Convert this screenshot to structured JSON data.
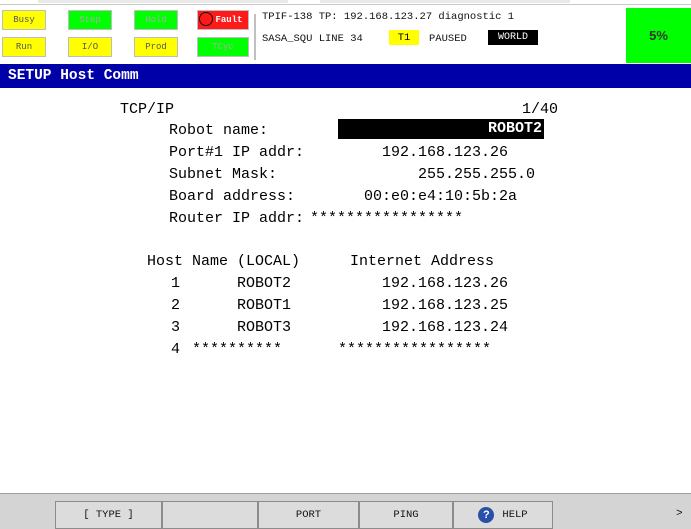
{
  "status": {
    "leds_top": [
      {
        "label": "Busy",
        "color": "#ffff00"
      },
      {
        "label": "Step",
        "color": "#00ff00"
      },
      {
        "label": "Hold",
        "color": "#00ff00"
      },
      {
        "label": "Fault",
        "color": "#ff1a1a"
      }
    ],
    "leds_bottom": [
      {
        "label": "Run",
        "color": "#ffff00"
      },
      {
        "label": "I/O",
        "color": "#ffff00"
      },
      {
        "label": "Prod",
        "color": "#ffff00"
      },
      {
        "label": "TCyc",
        "color": "#00ff00"
      }
    ],
    "message_line1": "TPIF-138 TP: 192.168.123.27 diagnostic 1",
    "program": "SASA_SQU LINE 34",
    "mode_badge": "T1",
    "run_state": "PAUSED",
    "coord_badge": "WORLD",
    "override": "5%"
  },
  "title": "SETUP Host Comm",
  "header": {
    "section": "TCP/IP",
    "page": "1/40"
  },
  "fields": [
    {
      "label": "Robot name:",
      "value": "ROBOT2"
    },
    {
      "label": "Port#1 IP addr:",
      "value": "192.168.123.26"
    },
    {
      "label": "Subnet Mask:",
      "value": "255.255.255.0"
    },
    {
      "label": "Board address:",
      "value": "00:e0:e4:10:5b:2a"
    },
    {
      "label": "Router IP addr:",
      "value": "*****************"
    }
  ],
  "host_table": {
    "col_host": "Host Name (LOCAL)",
    "col_addr": "Internet Address",
    "rows": [
      {
        "num": "1",
        "name": "ROBOT2",
        "addr": "192.168.123.26"
      },
      {
        "num": "2",
        "name": "ROBOT1",
        "addr": "192.168.123.25"
      },
      {
        "num": "3",
        "name": "ROBOT3",
        "addr": "192.168.123.24"
      },
      {
        "num": "4",
        "name": "**********",
        "addr": "*****************"
      }
    ]
  },
  "function_keys": [
    "[ TYPE ]",
    "",
    "PORT",
    "PING",
    "HELP"
  ],
  "next_key": ">"
}
